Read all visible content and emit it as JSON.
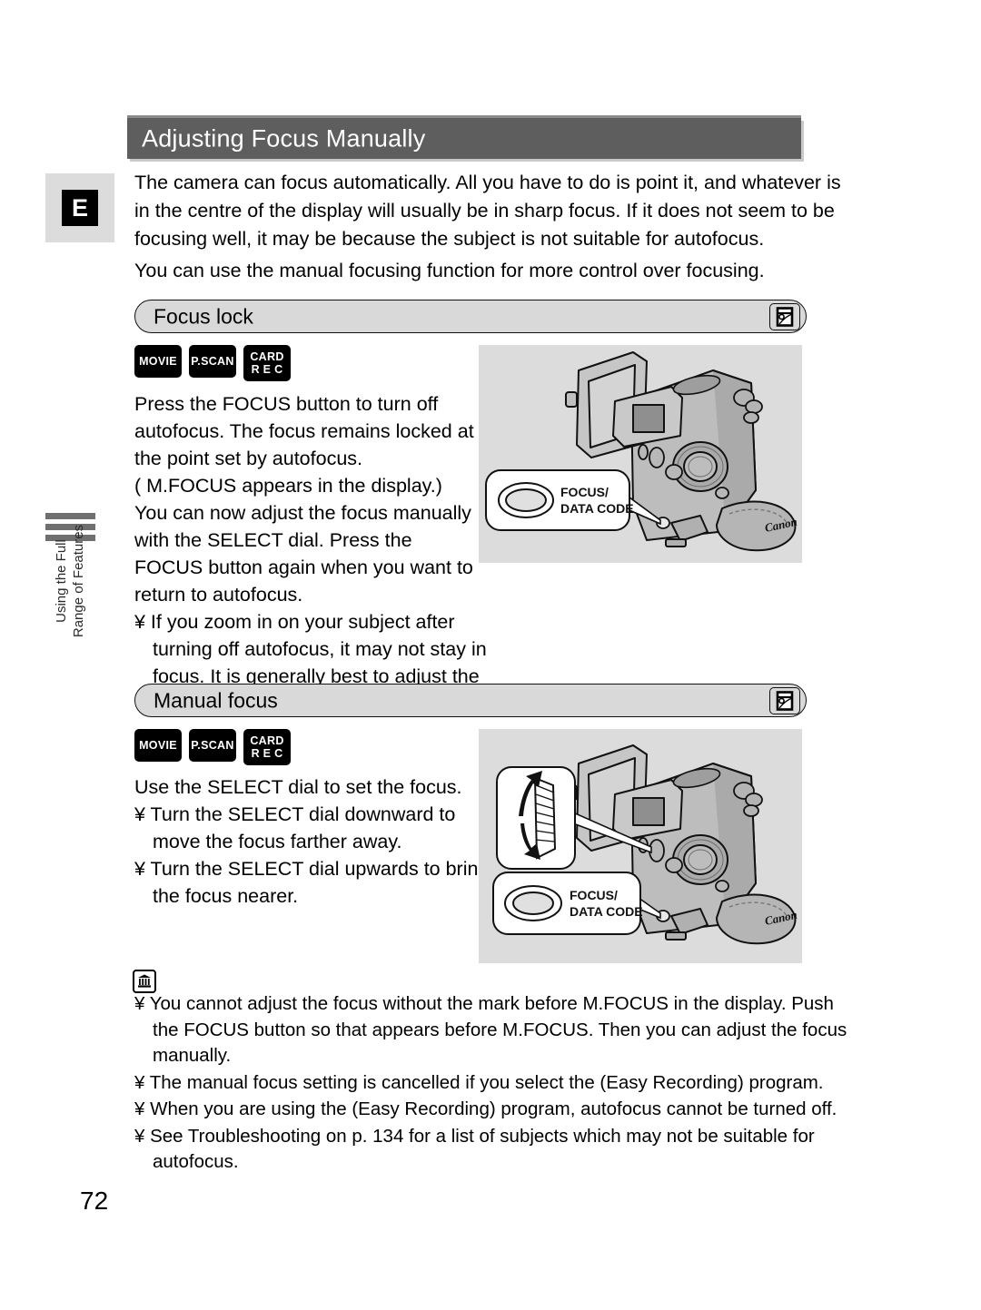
{
  "page": {
    "number": "72",
    "language_tab": "E",
    "side_tab_line1": "Using the Full",
    "side_tab_line2": "Range of Features"
  },
  "title": "Adjusting Focus Manually",
  "intro": {
    "paragraph1": "The camera can focus automatically. All you have to do is point it, and whatever is in the centre of the display will usually be in sharp focus. If it does not seem to be focusing well, it may be because the subject is not suitable for autofocus.",
    "paragraph2": "You can use the manual focusing function for more control over focusing."
  },
  "sections": [
    {
      "heading": "Focus lock",
      "badges": [
        {
          "line1": "MOVIE",
          "line2": ""
        },
        {
          "line1": "P.SCAN",
          "line2": ""
        },
        {
          "line1": "CARD",
          "line2": "R E C"
        }
      ],
      "body_lines": [
        "Press the FOCUS button to turn off",
        "autofocus. The focus remains locked at",
        "the point set by autofocus.",
        "(    M.FOCUS appears in the display.)",
        "You can now adjust the focus manually",
        "with the SELECT dial. Press the",
        "FOCUS button again when you want to",
        "return to autofocus."
      ],
      "bullets": [
        "¥ If you zoom in on your subject after turning off autofocus, it may not stay in focus. It is generally best to adjust the zoom first, and then the focus."
      ],
      "illustration": {
        "callout_button_line1": "FOCUS/",
        "callout_button_line2": "DATA CODE",
        "brand": "Canon"
      }
    },
    {
      "heading": "Manual focus",
      "badges": [
        {
          "line1": "MOVIE",
          "line2": ""
        },
        {
          "line1": "P.SCAN",
          "line2": ""
        },
        {
          "line1": "CARD",
          "line2": "R E C"
        }
      ],
      "body_lines": [
        "Use the SELECT dial to set the focus."
      ],
      "bullets": [
        "¥ Turn the SELECT dial downward to move the focus farther away.",
        "¥ Turn the SELECT dial upwards to bring the focus nearer."
      ],
      "illustration": {
        "callout_button_line1": "FOCUS/",
        "callout_button_line2": "DATA CODE",
        "brand": "Canon"
      }
    }
  ],
  "notes": [
    "¥ You cannot adjust the focus without the    mark before M.FOCUS in the display. Push the FOCUS button so that    appears before M.FOCUS. Then you can adjust the focus manually.",
    "¥ The manual focus setting is cancelled if you select  the  (Easy Recording) program.",
    "¥ When you are using the     (Easy Recording) program, autofocus cannot be turned off.",
    "¥ See  Troubleshooting  on p. 134 for a list of subjects which may not be suitable for autofocus."
  ],
  "colors": {
    "title_bar": "#5e5e5e",
    "panel_gray": "#dcdcdc",
    "pill_gray": "#d9d9d9",
    "badge_black": "#000000"
  }
}
